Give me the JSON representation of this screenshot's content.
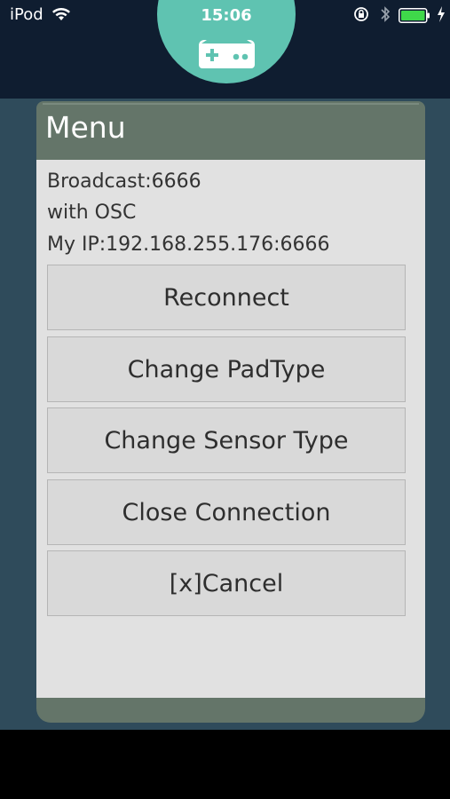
{
  "status_bar": {
    "carrier": "iPod",
    "time": "15:06",
    "battery_color": "#3fd84a"
  },
  "menu": {
    "title": "Menu",
    "info": {
      "broadcast": "Broadcast:6666",
      "protocol": "with OSC",
      "my_ip": "My IP:192.168.255.176:6666"
    },
    "buttons": {
      "reconnect": "Reconnect",
      "change_pad_type": "Change PadType",
      "change_sensor_type": "Change Sensor Type",
      "close_connection": "Close Connection",
      "cancel": "[x]Cancel"
    }
  },
  "colors": {
    "accent": "#5fc3b1",
    "header": "#0f1d30",
    "panel_header": "#647569",
    "panel_body": "#e1e1e1"
  }
}
